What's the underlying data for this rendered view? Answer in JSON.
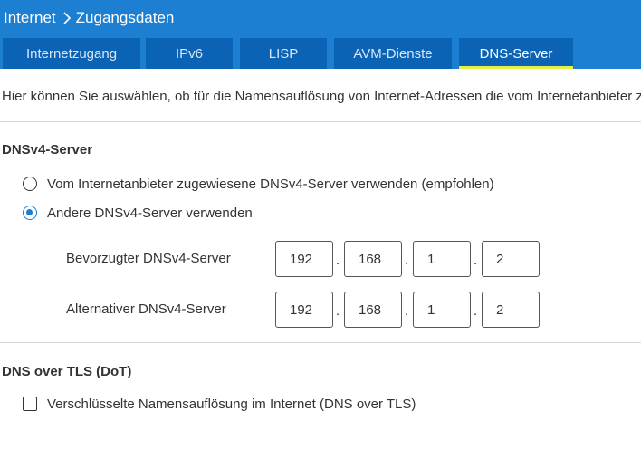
{
  "header": {
    "breadcrumb": [
      "Internet",
      "Zugangsdaten"
    ],
    "tabs": [
      {
        "label": "Internetzugang",
        "active": false
      },
      {
        "label": "IPv6",
        "active": false
      },
      {
        "label": "LISP",
        "active": false
      },
      {
        "label": "AVM-Dienste",
        "active": false
      },
      {
        "label": "DNS-Server",
        "active": true
      }
    ]
  },
  "intro_text": "Hier können Sie auswählen, ob für die Namensauflösung von Internet-Adressen die vom Internetanbieter zugewiesenen",
  "dnsv4": {
    "title": "DNSv4-Server",
    "options": [
      {
        "label": "Vom Internetanbieter zugewiesene DNSv4-Server verwenden (empfohlen)",
        "checked": false
      },
      {
        "label": "Andere DNSv4-Server verwenden",
        "checked": true
      }
    ],
    "preferred": {
      "label": "Bevorzugter DNSv4-Server",
      "octets": [
        "192",
        "168",
        "1",
        "2"
      ]
    },
    "alternative": {
      "label": "Alternativer DNSv4-Server",
      "octets": [
        "192",
        "168",
        "1",
        "2"
      ]
    },
    "separator": "."
  },
  "dot": {
    "title": "DNS over TLS (DoT)",
    "checkbox": {
      "label": "Verschlüsselte Namensauflösung im Internet (DNS over TLS)",
      "checked": false
    }
  },
  "colors": {
    "header_bg": "#1d7fd1",
    "tab_bg": "#0b63b6",
    "active_tab_underline": "#e4f04a",
    "radio_accent": "#1d7fd1"
  }
}
